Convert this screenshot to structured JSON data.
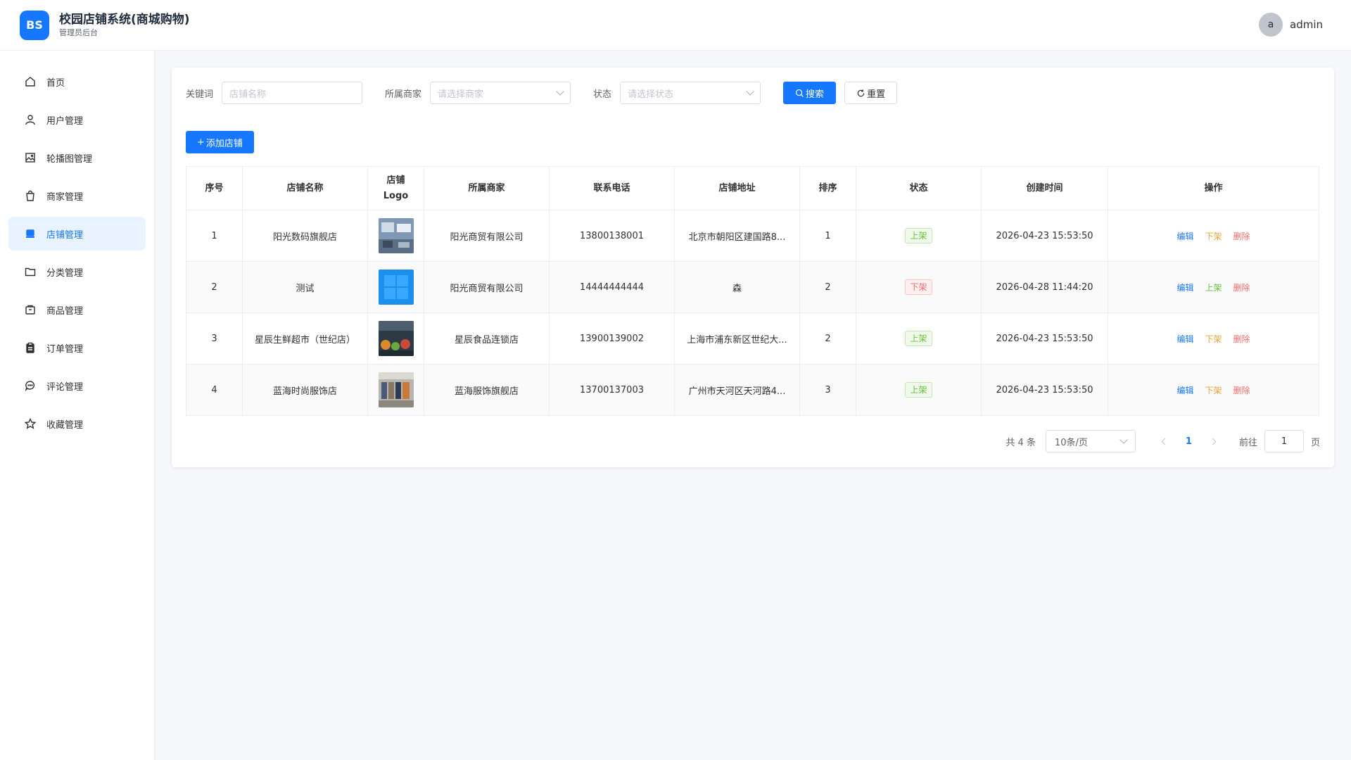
{
  "header": {
    "logo_text": "BS",
    "title": "校园店铺系统(商城购物)",
    "subtitle": "管理员后台",
    "avatar_letter": "a",
    "username": "admin"
  },
  "sidebar": {
    "items": [
      {
        "label": "首页",
        "icon": "home-icon"
      },
      {
        "label": "用户管理",
        "icon": "user-icon"
      },
      {
        "label": "轮播图管理",
        "icon": "image-icon"
      },
      {
        "label": "商家管理",
        "icon": "bag-icon"
      },
      {
        "label": "店铺管理",
        "icon": "shop-icon",
        "active": true
      },
      {
        "label": "分类管理",
        "icon": "folder-icon"
      },
      {
        "label": "商品管理",
        "icon": "goods-icon"
      },
      {
        "label": "订单管理",
        "icon": "clipboard-icon"
      },
      {
        "label": "评论管理",
        "icon": "chat-icon"
      },
      {
        "label": "收藏管理",
        "icon": "star-icon"
      }
    ]
  },
  "filters": {
    "keyword_label": "关键词",
    "keyword_placeholder": "店铺名称",
    "merchant_label": "所属商家",
    "merchant_placeholder": "请选择商家",
    "status_label": "状态",
    "status_placeholder": "请选择状态",
    "search_label": "搜索",
    "reset_label": "重置"
  },
  "add_label": "添加店铺",
  "table": {
    "headers": [
      "序号",
      "店铺名称",
      "店铺",
      "Logo",
      "所属商家",
      "联系电话",
      "店铺地址",
      "排序",
      "状态",
      "创建时间",
      "操作"
    ],
    "rows": [
      {
        "no": "1",
        "name": "阳光数码旗舰店",
        "merchant": "阳光商贸有限公司",
        "phone": "13800138001",
        "address": "北京市朝阳区建国路8...",
        "sort": "1",
        "status": "上架",
        "created": "2026-04-23 15:53:50",
        "op_edit": "编辑",
        "op_toggle": "下架",
        "op_delete": "删除"
      },
      {
        "no": "2",
        "name": "测试",
        "merchant": "阳光商贸有限公司",
        "phone": "14444444444",
        "address": "森",
        "sort": "2",
        "status": "下架",
        "created": "2026-04-28 11:44:20",
        "op_edit": "编辑",
        "op_toggle": "上架",
        "op_delete": "删除"
      },
      {
        "no": "3",
        "name": "星辰生鲜超市（世纪店）",
        "merchant": "星辰食品连锁店",
        "phone": "13900139002",
        "address": "上海市浦东新区世纪大...",
        "sort": "2",
        "status": "上架",
        "created": "2026-04-23 15:53:50",
        "op_edit": "编辑",
        "op_toggle": "下架",
        "op_delete": "删除"
      },
      {
        "no": "4",
        "name": "蓝海时尚服饰店",
        "merchant": "蓝海服饰旗舰店",
        "phone": "13700137003",
        "address": "广州市天河区天河路4...",
        "sort": "3",
        "status": "上架",
        "created": "2026-04-23 15:53:50",
        "op_edit": "编辑",
        "op_toggle": "下架",
        "op_delete": "删除"
      }
    ]
  },
  "pagination": {
    "total": "共 4 条",
    "page_size": "10条/页",
    "current": "1",
    "goto_label": "前往",
    "goto_value": "1",
    "page_suffix": "页"
  },
  "colors": {
    "primary": "#1677ff",
    "success": "#67c23a",
    "warning": "#e6a23c",
    "danger": "#f56c6c"
  }
}
